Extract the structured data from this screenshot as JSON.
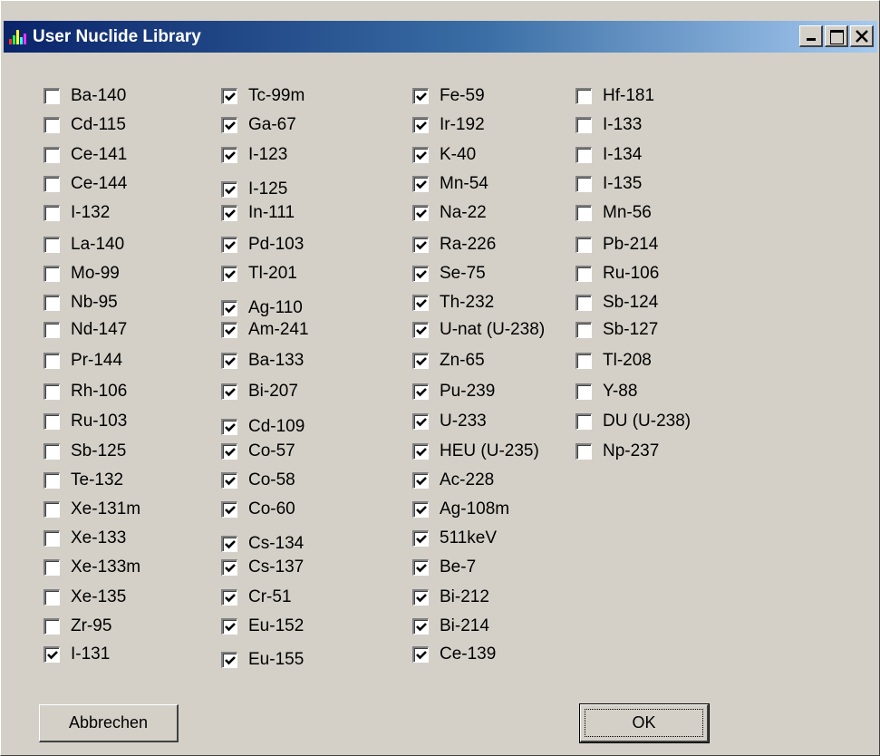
{
  "window": {
    "title": "User Nuclide Library",
    "close_glyph": "✕"
  },
  "columns": [
    {
      "items": [
        {
          "label": "Ba-140",
          "checked": false
        },
        {
          "label": "Cd-115",
          "checked": false
        },
        {
          "label": "Ce-141",
          "checked": false
        },
        {
          "label": "Ce-144",
          "checked": false
        },
        {
          "label": "I-132",
          "checked": false
        },
        {
          "label": "La-140",
          "checked": false
        },
        {
          "label": "Mo-99",
          "checked": false
        },
        {
          "label": "Nb-95",
          "checked": false
        },
        {
          "label": "Nd-147",
          "checked": false
        },
        {
          "label": "Pr-144",
          "checked": false
        },
        {
          "label": "Rh-106",
          "checked": false
        },
        {
          "label": "Ru-103",
          "checked": false
        },
        {
          "label": "Sb-125",
          "checked": false
        },
        {
          "label": "Te-132",
          "checked": false
        },
        {
          "label": "Xe-131m",
          "checked": false
        },
        {
          "label": "Xe-133",
          "checked": false
        },
        {
          "label": "Xe-133m",
          "checked": false
        },
        {
          "label": "Xe-135",
          "checked": false
        },
        {
          "label": "Zr-95",
          "checked": false
        },
        {
          "label": "I-131",
          "checked": true
        }
      ]
    },
    {
      "items": [
        {
          "label": "Tc-99m",
          "checked": true
        },
        {
          "label": "Ga-67",
          "checked": true
        },
        {
          "label": "I-123",
          "checked": true
        },
        {
          "label": "I-125",
          "checked": true
        },
        {
          "label": "In-111",
          "checked": true
        },
        {
          "label": "Pd-103",
          "checked": true
        },
        {
          "label": "Tl-201",
          "checked": true
        },
        {
          "label": "Ag-110",
          "checked": true
        },
        {
          "label": "Am-241",
          "checked": true
        },
        {
          "label": "Ba-133",
          "checked": true
        },
        {
          "label": "Bi-207",
          "checked": true
        },
        {
          "label": "Cd-109",
          "checked": true
        },
        {
          "label": "Co-57",
          "checked": true
        },
        {
          "label": "Co-58",
          "checked": true
        },
        {
          "label": "Co-60",
          "checked": true
        },
        {
          "label": "Cs-134",
          "checked": true
        },
        {
          "label": "Cs-137",
          "checked": true
        },
        {
          "label": "Cr-51",
          "checked": true
        },
        {
          "label": "Eu-152",
          "checked": true
        },
        {
          "label": "Eu-155",
          "checked": true
        }
      ]
    },
    {
      "items": [
        {
          "label": "Fe-59",
          "checked": true
        },
        {
          "label": "Ir-192",
          "checked": true
        },
        {
          "label": "K-40",
          "checked": true
        },
        {
          "label": "Mn-54",
          "checked": true
        },
        {
          "label": "Na-22",
          "checked": true
        },
        {
          "label": "Ra-226",
          "checked": true
        },
        {
          "label": "Se-75",
          "checked": true
        },
        {
          "label": "Th-232",
          "checked": true
        },
        {
          "label": "U-nat (U-238)",
          "checked": true
        },
        {
          "label": "Zn-65",
          "checked": true
        },
        {
          "label": "Pu-239",
          "checked": true
        },
        {
          "label": "U-233",
          "checked": true
        },
        {
          "label": "HEU (U-235)",
          "checked": true
        },
        {
          "label": "Ac-228",
          "checked": true
        },
        {
          "label": "Ag-108m",
          "checked": true
        },
        {
          "label": "511keV",
          "checked": true
        },
        {
          "label": "Be-7",
          "checked": true
        },
        {
          "label": "Bi-212",
          "checked": true
        },
        {
          "label": "Bi-214",
          "checked": true
        },
        {
          "label": "Ce-139",
          "checked": true
        }
      ]
    },
    {
      "items": [
        {
          "label": "Hf-181",
          "checked": false
        },
        {
          "label": "I-133",
          "checked": false
        },
        {
          "label": "I-134",
          "checked": false
        },
        {
          "label": "I-135",
          "checked": false
        },
        {
          "label": "Mn-56",
          "checked": false
        },
        {
          "label": "Pb-214",
          "checked": false
        },
        {
          "label": "Ru-106",
          "checked": false
        },
        {
          "label": "Sb-124",
          "checked": false
        },
        {
          "label": "Sb-127",
          "checked": false
        },
        {
          "label": "Tl-208",
          "checked": false
        },
        {
          "label": "Y-88",
          "checked": false
        },
        {
          "label": "DU (U-238)",
          "checked": false
        },
        {
          "label": "Np-237",
          "checked": false
        }
      ]
    }
  ],
  "buttons": {
    "cancel_label": "Abbrechen",
    "ok_label": "OK"
  }
}
